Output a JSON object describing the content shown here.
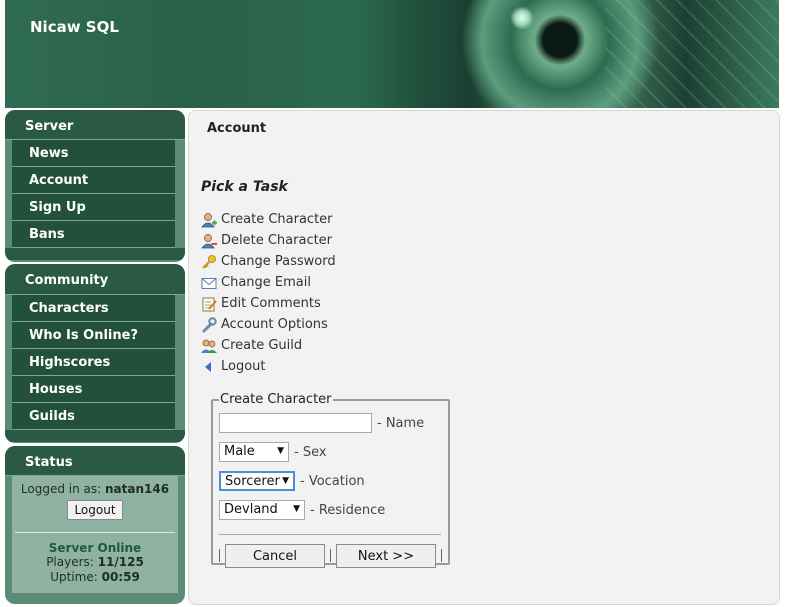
{
  "header": {
    "site_title": "Nicaw SQL"
  },
  "sidebar": {
    "server": {
      "title": "Server",
      "items": [
        "News",
        "Account",
        "Sign Up",
        "Bans"
      ]
    },
    "community": {
      "title": "Community",
      "items": [
        "Characters",
        "Who Is Online?",
        "Highscores",
        "Houses",
        "Guilds"
      ]
    },
    "status": {
      "title": "Status",
      "logged_in_label": "Logged in as:",
      "username": "natan146",
      "logout_label": "Logout",
      "server_state": "Server Online",
      "players_label": "Players:",
      "players_value": "11/125",
      "uptime_label": "Uptime:",
      "uptime_value": "00:59"
    }
  },
  "main": {
    "title": "Account",
    "task_heading": "Pick a Task",
    "tasks": [
      {
        "label": "Create Character",
        "icon": "user-add-icon"
      },
      {
        "label": "Delete Character",
        "icon": "user-delete-icon"
      },
      {
        "label": "Change Password",
        "icon": "key-icon"
      },
      {
        "label": "Change Email",
        "icon": "envelope-icon"
      },
      {
        "label": "Edit Comments",
        "icon": "edit-note-icon"
      },
      {
        "label": "Account Options",
        "icon": "wrench-icon"
      },
      {
        "label": "Create Guild",
        "icon": "group-icon"
      },
      {
        "label": "Logout",
        "icon": "back-arrow-icon"
      }
    ],
    "form": {
      "legend": "Create Character",
      "name_value": "",
      "name_label": "- Name",
      "sex_value": "Male",
      "sex_label": "- Sex",
      "vocation_value": "Sorcerer",
      "vocation_label": "- Vocation",
      "residence_value": "Devland",
      "residence_label": "- Residence",
      "cancel_label": "Cancel",
      "next_label": "Next >>"
    }
  },
  "colors": {
    "sidebar_dark": "#23503b",
    "sidebar_head": "#2a5a44",
    "status_bg": "#8fb2a2",
    "server_online": "#1e5a3c"
  }
}
